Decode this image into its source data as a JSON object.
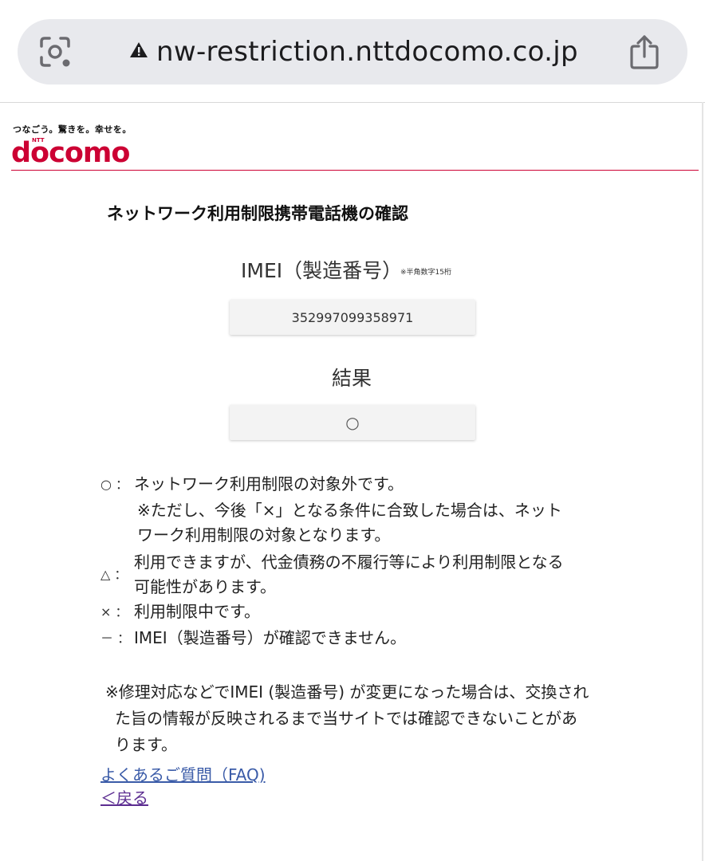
{
  "browser": {
    "url": "nw-restriction.nttdocomo.co.jp",
    "lens_icon": "camera-search-icon",
    "warning_icon": "warning-icon",
    "share_icon": "share-icon"
  },
  "header": {
    "tagline": "つなごう。驚きを。幸せを。",
    "logo_ntt": "NTT",
    "logo_word": "docomo",
    "brand_color": "#cc0033"
  },
  "page": {
    "title": "ネットワーク利用制限携帯電話機の確認",
    "imei_label": "IMEI（製造番号）",
    "imei_note": "※半角数字15桁",
    "imei_value": "352997099358971",
    "result_label": "結果",
    "result_value": "○"
  },
  "legend": {
    "circle_sym": "○ ：",
    "circle_line1": "ネットワーク利用制限の対象外です。",
    "circle_line2": "※ただし、今後「×」となる条件に合致した場合は、ネット",
    "circle_line3": "ワーク利用制限の対象となります。",
    "triangle_sym": "△ ：",
    "triangle_line1": "利用できますが、代金債務の不履行等により利用制限となる",
    "triangle_line2": "可能性があります。",
    "cross_sym": "× ：",
    "cross_line1": "利用制限中です。",
    "dash_sym": "－ ：",
    "dash_line1": "IMEI（製造番号）が確認できません。"
  },
  "note": {
    "line1": "※修理対応などでIMEI (製造番号) が変更になった場合は、交換され",
    "line2": "た旨の情報が反映されるまで当サイトでは確認できないことがあ",
    "line3": "ります。"
  },
  "links": {
    "faq": "よくあるご質問（FAQ)",
    "back": "＜戻る"
  }
}
